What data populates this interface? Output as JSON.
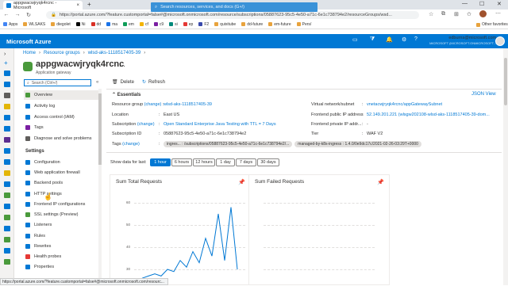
{
  "browser": {
    "tab_title": "appgwacwjryqk4rcnc - Microsoft",
    "new_tab": "+",
    "url": "https://portal.azure.com/?feature.customportal=false#@microsoft.onmicrosoft.com/resource/subscriptions/05887623-95c5-4e50-a71c-6e1c738794e2/resourceGroups/wsd...",
    "bookmarks": [
      "Apps",
      "WLSAKS",
      "diegolet",
      "Ni",
      "dd",
      "ma",
      "em",
      "cf",
      "c9",
      "si",
      "ep",
      "F2",
      "quixitube",
      "dd-future",
      "em-future",
      "Pers/"
    ],
    "other_favorites": "Other favorites"
  },
  "azure": {
    "brand": "Microsoft Azure",
    "search_placeholder": "Search resources, services, and docs (G+/)",
    "account_email": "edburns@microsoft.com",
    "account_dir": "MICROSOFT (MICROSOFT.ONMICROSOFT..."
  },
  "breadcrumb": [
    "Home",
    "Resource groups",
    "wlsd-aks-1118517405-39"
  ],
  "resource": {
    "title": "appgwacwjryqk4rcnc",
    "subtitle": "Application gateway"
  },
  "menu": {
    "search_placeholder": "Search (Ctrl+/)",
    "top_items": [
      "Overview",
      "Activity log",
      "Access control (IAM)",
      "Tags",
      "Diagnose and solve problems"
    ],
    "settings_header": "Settings",
    "settings_items": [
      "Configuration",
      "Web application firewall",
      "Backend pools",
      "HTTP settings",
      "Frontend IP configurations",
      "SSL settings (Preview)",
      "Listeners",
      "Rules",
      "Rewrites",
      "Health probes",
      "Properties"
    ]
  },
  "toolbar": {
    "delete": "Delete",
    "refresh": "Refresh"
  },
  "essentials": {
    "header": "Essentials",
    "json_view": "JSON View",
    "left": [
      {
        "key": "Resource group",
        "change": "(change)",
        "value": "wlsd-aks-1118517405-39"
      },
      {
        "key": "Location",
        "value": "East US"
      },
      {
        "key": "Subscription",
        "change": "(change)",
        "value": "Open Standard Enterprise Java Testing with TTL = 7 Days"
      },
      {
        "key": "Subscription ID",
        "value": "05887623-95c5-4e50-a71c-6e1c738794e2"
      }
    ],
    "right": [
      {
        "key": "Virtual network/subnet",
        "value": "vnetacwjryqk4rcnc/appGatewaySubnet"
      },
      {
        "key": "Frontend public IP address",
        "value": "52.149.201.221 (wlsgw202108-wlsd-aks-1118517405-39-dom..."
      },
      {
        "key": "Frontend private IP addr...",
        "value": "-"
      },
      {
        "key": "Tier",
        "value": "WAF V2"
      }
    ],
    "tags_key": "Tags",
    "tags_change": "(change)",
    "tags": [
      "ingres... : /subscriptions/05887623-95c5-4e50-a71c-6e1c738794e2/...",
      "managed-by-k8s-ingress : 1.4.0/0e9dc17c/2021-02-26-03:29T+0000"
    ]
  },
  "timefilter": {
    "label": "Show data for last:",
    "options": [
      "1 hour",
      "6 hours",
      "12 hours",
      "1 day",
      "7 days",
      "30 days"
    ],
    "selected": "1 hour"
  },
  "charts": {
    "left_title": "Sum Total Requests",
    "right_title": "Sum Failed Requests",
    "left_ticks": [
      "60",
      "50",
      "40",
      "30"
    ],
    "accent": "#0078d4"
  },
  "chart_data": [
    {
      "type": "line",
      "title": "Sum Total Requests",
      "ylim": [
        25,
        65
      ],
      "y_ticks": [
        60,
        50,
        40,
        30
      ],
      "series": [
        {
          "values": [
            26,
            27,
            28,
            27,
            30,
            29,
            34,
            31,
            38,
            33,
            44,
            36,
            55,
            34,
            58,
            30
          ]
        }
      ]
    },
    {
      "type": "line",
      "title": "Sum Failed Requests",
      "series": []
    }
  ],
  "status_url": "https://portal.azure.com/?feature.customportal=false#@microsoft.onmicrosoft.com/resourc..."
}
